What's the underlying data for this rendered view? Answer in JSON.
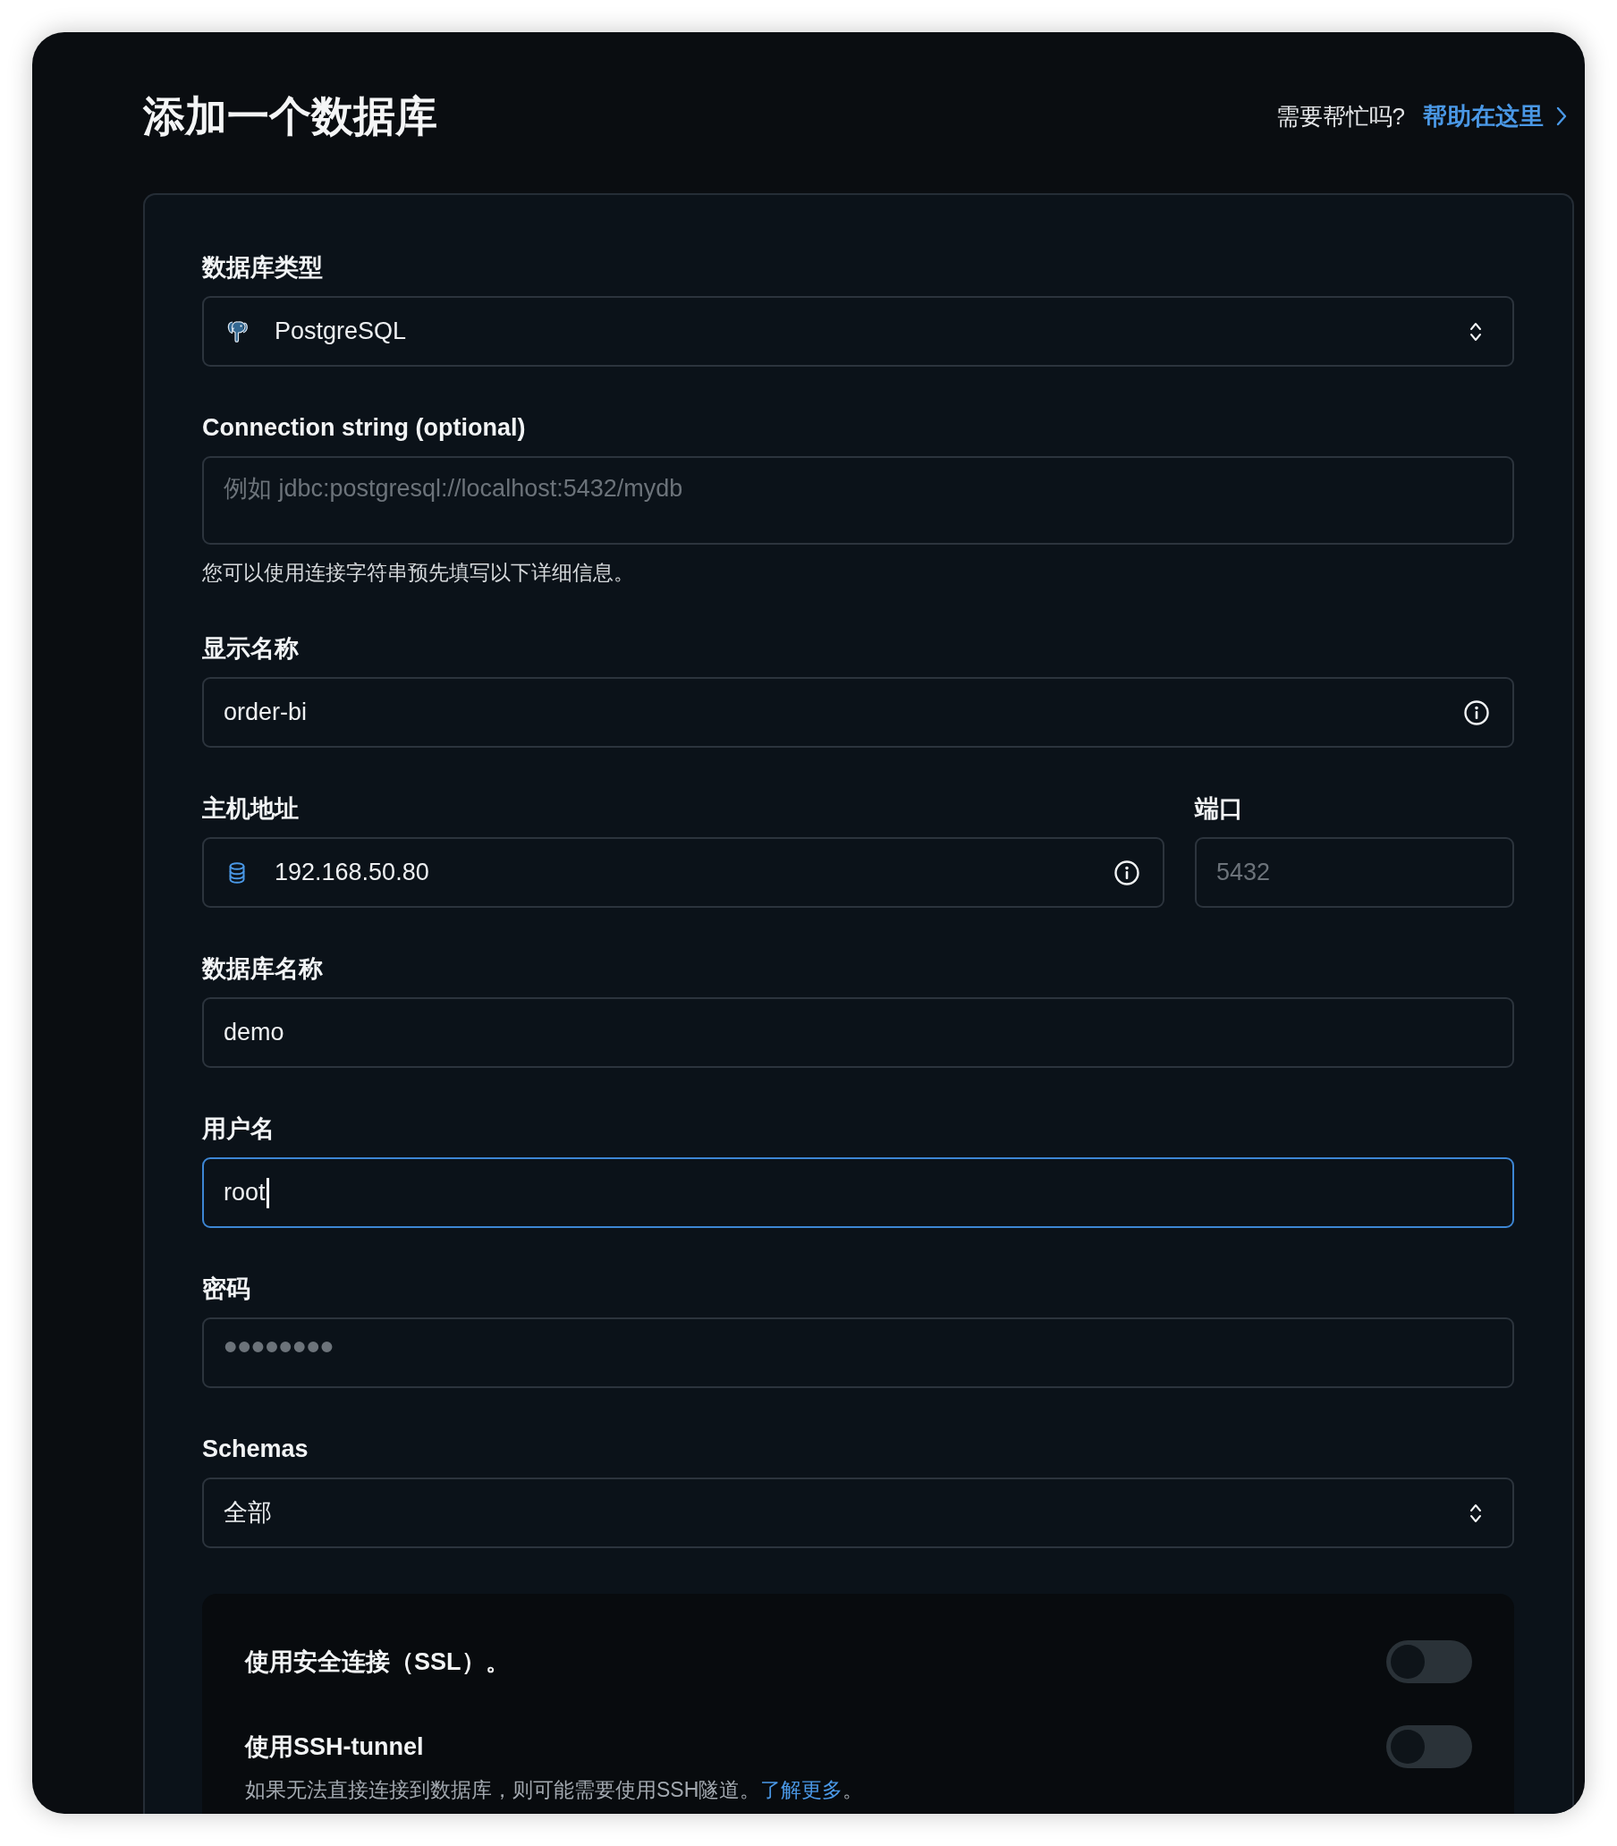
{
  "header": {
    "title": "添加一个数据库",
    "help_prompt": "需要帮忙吗?",
    "help_link": "帮助在这里"
  },
  "fields": [
    {
      "kind": "engine-select",
      "label": "数据库类型",
      "value": "PostgreSQL",
      "focused": false
    },
    {
      "kind": "textarea",
      "label": "Connection string (optional)",
      "placeholder": "例如 jdbc:postgresql://localhost:5432/mydb",
      "help": "您可以使用连接字符串预先填写以下详细信息。",
      "focused": false
    },
    {
      "kind": "input",
      "label": "显示名称",
      "value": "order-bi",
      "info": true,
      "focused": false
    },
    {
      "kind": "pair",
      "items": [
        {
          "kind": "host",
          "label": "主机地址",
          "value": "192.168.50.80",
          "info": true,
          "focused": false
        },
        {
          "kind": "input",
          "label": "端口",
          "placeholder": "5432",
          "focused": false
        }
      ]
    },
    {
      "kind": "input",
      "label": "数据库名称",
      "value": "demo",
      "focused": false
    },
    {
      "kind": "input",
      "label": "用户名",
      "value": "root",
      "focused": true
    },
    {
      "kind": "password",
      "label": "密码",
      "placeholder": "••••••••",
      "focused": false
    },
    {
      "kind": "select",
      "label": "Schemas",
      "value": "全部",
      "focused": false
    }
  ],
  "toggles": [
    {
      "label": "使用安全连接（SSL）。",
      "on": false
    },
    {
      "label": "使用SSH-tunnel",
      "on": false,
      "description": "如果无法直接连接到数据库，则可能需要使用SSH隧道。",
      "link": "了解更多",
      "description_end": "。"
    }
  ]
}
